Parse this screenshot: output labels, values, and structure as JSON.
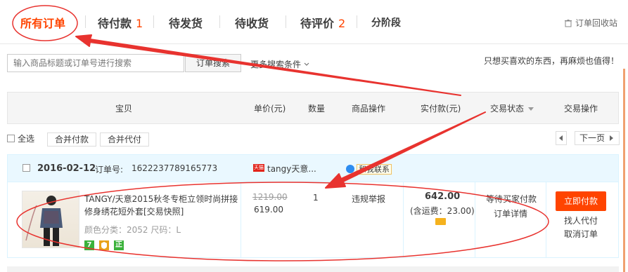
{
  "tabs": [
    {
      "label": "所有订单",
      "count": ""
    },
    {
      "label": "待付款",
      "count": "1"
    },
    {
      "label": "待发货",
      "count": ""
    },
    {
      "label": "待收货",
      "count": ""
    },
    {
      "label": "待评价",
      "count": "2"
    },
    {
      "label": "分阶段",
      "count": ""
    }
  ],
  "recycle_label": "订单回收站",
  "search": {
    "placeholder": "输入商品标题或订单号进行搜索",
    "button": "订单搜索",
    "more": "更多搜索条件"
  },
  "slogan": "只想买喜欢的东西，再麻烦也值得！",
  "columns": [
    "宝贝",
    "单价(元)",
    "数量",
    "商品操作",
    "实付款(元)",
    "交易状态",
    "交易操作"
  ],
  "toolbar": {
    "select_all": "全选",
    "merge_pay": "合并付款",
    "merge_proxy": "合并代付",
    "next_page": "下一页"
  },
  "order": {
    "date": "2016-02-12",
    "order_no_label": "订单号:",
    "order_no": "1622237789165773",
    "shop_icon": "天猫",
    "shop": "tangy天意...",
    "contact": "和我联系",
    "title_line1": "TANGY/天意2015秋冬专柜立领时尚拼接",
    "title_line2": "修身绣花短外套[交易快照]",
    "spec": "颜色分类：2052  尺码：L",
    "badges": [
      "7",
      "",
      "正"
    ],
    "orig_price": "1219.00",
    "price": "619.00",
    "qty": "1",
    "op": "违规举报",
    "paid": "642.00",
    "shipping": "(含运费：23.00)",
    "status": "等待买家付款",
    "detail": "订单详情",
    "pay_button": "立即付款",
    "proxy_pay": "找人代付",
    "cancel": "取消订单"
  },
  "colors": {
    "accent": "#ff4400",
    "annotation": "#e8332f"
  }
}
